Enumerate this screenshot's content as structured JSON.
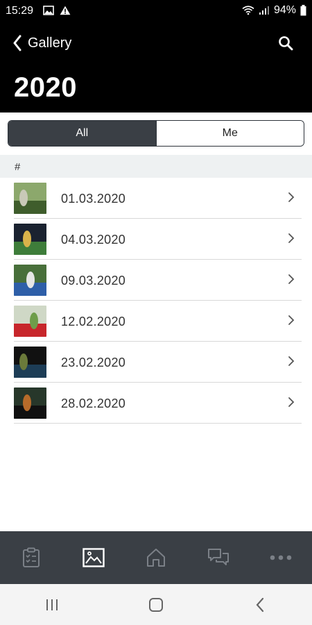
{
  "status_bar": {
    "time": "15:29",
    "battery": "94%"
  },
  "header": {
    "back_label": "Gallery",
    "title": "2020"
  },
  "tabs": [
    {
      "label": "All",
      "selected": true
    },
    {
      "label": "Me",
      "selected": false
    }
  ],
  "section": {
    "label": "#"
  },
  "albums": [
    {
      "date": "01.03.2020",
      "thumb_colors": [
        "#8ca86c",
        "#3f5d2c",
        "#c9c9b8"
      ]
    },
    {
      "date": "04.03.2020",
      "thumb_colors": [
        "#1a2230",
        "#3e7d3a",
        "#d9b34a"
      ]
    },
    {
      "date": "09.03.2020",
      "thumb_colors": [
        "#486f3a",
        "#2e5fa8",
        "#e6e6e6"
      ]
    },
    {
      "date": "12.02.2020",
      "thumb_colors": [
        "#cfd8c6",
        "#c7262b",
        "#6e9d4a"
      ]
    },
    {
      "date": "23.02.2020",
      "thumb_colors": [
        "#111111",
        "#1d3d56",
        "#6b7a3a"
      ]
    },
    {
      "date": "28.02.2020",
      "thumb_colors": [
        "#27372a",
        "#101010",
        "#b76b2a"
      ]
    }
  ],
  "bottom_nav": [
    {
      "icon": "clipboard-icon",
      "active": false
    },
    {
      "icon": "gallery-icon",
      "active": true
    },
    {
      "icon": "home-icon",
      "active": false
    },
    {
      "icon": "chat-icon",
      "active": false
    },
    {
      "icon": "more-icon",
      "active": false
    }
  ],
  "colors": {
    "accent": "#3a3f45",
    "header_bg": "#000000",
    "section_bg": "#eef1f2"
  }
}
